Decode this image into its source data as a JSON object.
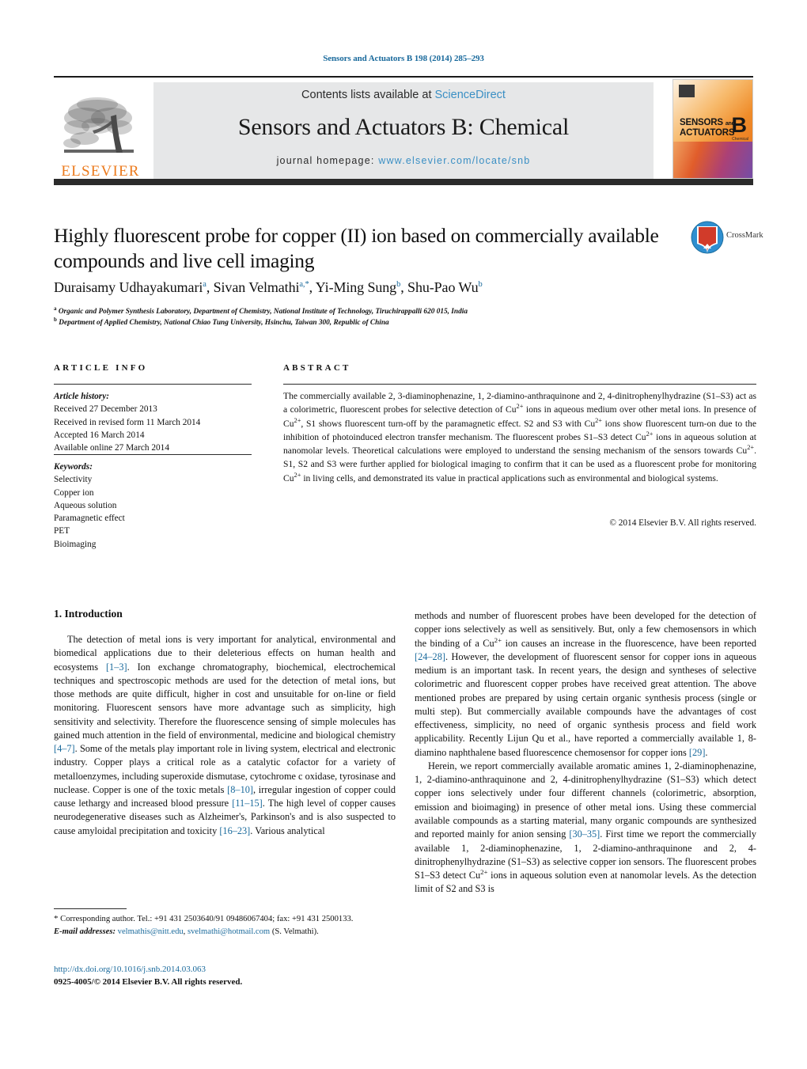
{
  "running_head": "Sensors and Actuators B 198 (2014) 285–293",
  "masthead": {
    "contents_prefix": "Contents lists available at ",
    "sciencedirect": "ScienceDirect",
    "journal_title": "Sensors and Actuators B: Chemical",
    "homepage_label": "journal homepage:",
    "homepage_url": "www.elsevier.com/locate/snb",
    "publisher_name": "ELSEVIER",
    "cover_line1": "SENSORS",
    "cover_and": "and",
    "cover_line2": "ACTUATORS",
    "cover_letter": "B",
    "cover_sub": "Chemical",
    "accent_orange": "#ec7a1c",
    "link_blue": "#3a8fc4"
  },
  "article": {
    "title": "Highly fluorescent probe for copper (II) ion based on commercially available compounds and live cell imaging",
    "authors_html": "Duraisamy Udhayakumari<sup>a</sup>, Sivan Velmathi<sup>a,*</sup>, Yi-Ming Sung<sup>b</sup>, Shu-Pao Wu<sup>b</sup>",
    "affiliation_a": "Organic and Polymer Synthesis Laboratory, Department of Chemistry, National Institute of Technology, Tiruchirappalli 620 015, India",
    "affiliation_b": "Department of Applied Chemistry, National Chiao Tung University, Hsinchu, Taiwan 300, Republic of China",
    "crossmark_label": "CrossMark"
  },
  "article_info": {
    "heading": "ARTICLE INFO",
    "history_label": "Article history:",
    "history": [
      "Received 27 December 2013",
      "Received in revised form 11 March 2014",
      "Accepted 16 March 2014",
      "Available online 27 March 2014"
    ],
    "keywords_label": "Keywords:",
    "keywords": [
      "Selectivity",
      "Copper ion",
      "Aqueous solution",
      "Paramagnetic effect",
      "PET",
      "Bioimaging"
    ]
  },
  "abstract": {
    "heading": "ABSTRACT",
    "text_html": "The commercially available 2, 3-diaminophenazine, 1, 2-diamino-anthraquinone and 2, 4-dinitrophenylhydrazine (S1–S3) act as a colorimetric, fluorescent probes for selective detection of Cu<sup>2+</sup> ions in aqueous medium over other metal ions. In presence of Cu<sup>2+</sup>, S1 shows fluorescent turn-off by the paramagnetic effect. S2 and S3 with Cu<sup>2+</sup> ions show fluorescent turn-on due to the inhibition of photoinduced electron transfer mechanism. The fluorescent probes S1–S3 detect Cu<sup>2+</sup> ions in aqueous solution at nanomolar levels. Theoretical calculations were employed to understand the sensing mechanism of the sensors towards Cu<sup>2+</sup>. S1, S2 and S3 were further applied for biological imaging to confirm that it can be used as a fluorescent probe for monitoring Cu<sup>2+</sup> in living cells, and demonstrated its value in practical applications such as environmental and biological systems.",
    "copyright": "© 2014 Elsevier B.V. All rights reserved."
  },
  "body": {
    "section_title": "1. Introduction",
    "left_column_html": "<p class=\"indent\">The detection of metal ions is very important for analytical, environmental and biomedical applications due to their deleterious effects on human health and ecosystems <span class=\"ref\">[1–3]</span>. Ion exchange chromatography, biochemical, electrochemical techniques and spectroscopic methods are used for the detection of metal ions, but those methods are quite difficult, higher in cost and unsuitable for on-line or field monitoring. Fluorescent sensors have more advantage such as simplicity, high sensitivity and selectivity. Therefore the fluorescence sensing of simple molecules has gained much attention in the field of environmental, medicine and biological chemistry <span class=\"ref\">[4–7]</span>. Some of the metals play important role in living system, electrical and electronic industry. Copper plays a critical role as a catalytic cofactor for a variety of metalloenzymes, including superoxide dismutase, cytochrome c oxidase, tyrosinase and nuclease. Copper is one of the toxic metals <span class=\"ref\">[8–10]</span>, irregular ingestion of copper could cause lethargy and increased blood pressure <span class=\"ref\">[11–15]</span>. The high level of copper causes neurodegenerative diseases such as Alzheimer's, Parkinson's and is also suspected to cause amyloidal precipitation and toxicity <span class=\"ref\">[16–23]</span>. Various analytical</p>",
    "right_column_html": "<p>methods and number of fluorescent probes have been developed for the detection of copper ions selectively as well as sensitively. But, only a few chemosensors in which the binding of a Cu<sup>2+</sup> ion causes an increase in the fluorescence, have been reported <span class=\"ref\">[24–28]</span>. However, the development of fluorescent sensor for copper ions in aqueous medium is an important task. In recent years, the design and syntheses of selective colorimetric and fluorescent copper probes have received great attention. The above mentioned probes are prepared by using certain organic synthesis process (single or multi step). But commercially available compounds have the advantages of cost effectiveness, simplicity, no need of organic synthesis process and field work applicability. Recently Lijun Qu et al., have reported a commercially available 1, 8-diamino naphthalene based fluorescence chemosensor for copper ions <span class=\"ref\">[29]</span>.</p><p class=\"indent\">Herein, we report commercially available aromatic amines 1, 2-diaminophenazine, 1, 2-diamino-anthraquinone and 2, 4-dinitrophenylhydrazine (S1–S3) which detect copper ions selectively under four different channels (colorimetric, absorption, emission and bioimaging) in presence of other metal ions. Using these commercial available compounds as a starting material, many organic compounds are synthesized and reported mainly for anion sensing <span class=\"ref\">[30–35]</span>. First time we report the commercially available 1, 2-diaminophenazine, 1, 2-diamino-anthraquinone and 2, 4-dinitrophenylhydrazine (S1–S3) as selective copper ion sensors. The fluorescent probes S1–S3 detect Cu<sup>2+</sup> ions in aqueous solution even at nanomolar levels. As the detection limit of S2 and S3 is</p>"
  },
  "footer": {
    "corresponding_html": "<span style=\"font-size:11px\">*</span> Corresponding author. Tel.: +91 431 2503640/91 09486067404; fax: +91 431 2500133.",
    "email_label": "E-mail addresses:",
    "email1": "velmathis@nitt.edu",
    "email2": "svelmathi@hotmail.com",
    "email_owner": "(S. Velmathi).",
    "doi_url": "http://dx.doi.org/10.1016/j.snb.2014.03.063",
    "issn_line": "0925-4005/© 2014 Elsevier B.V. All rights reserved."
  }
}
